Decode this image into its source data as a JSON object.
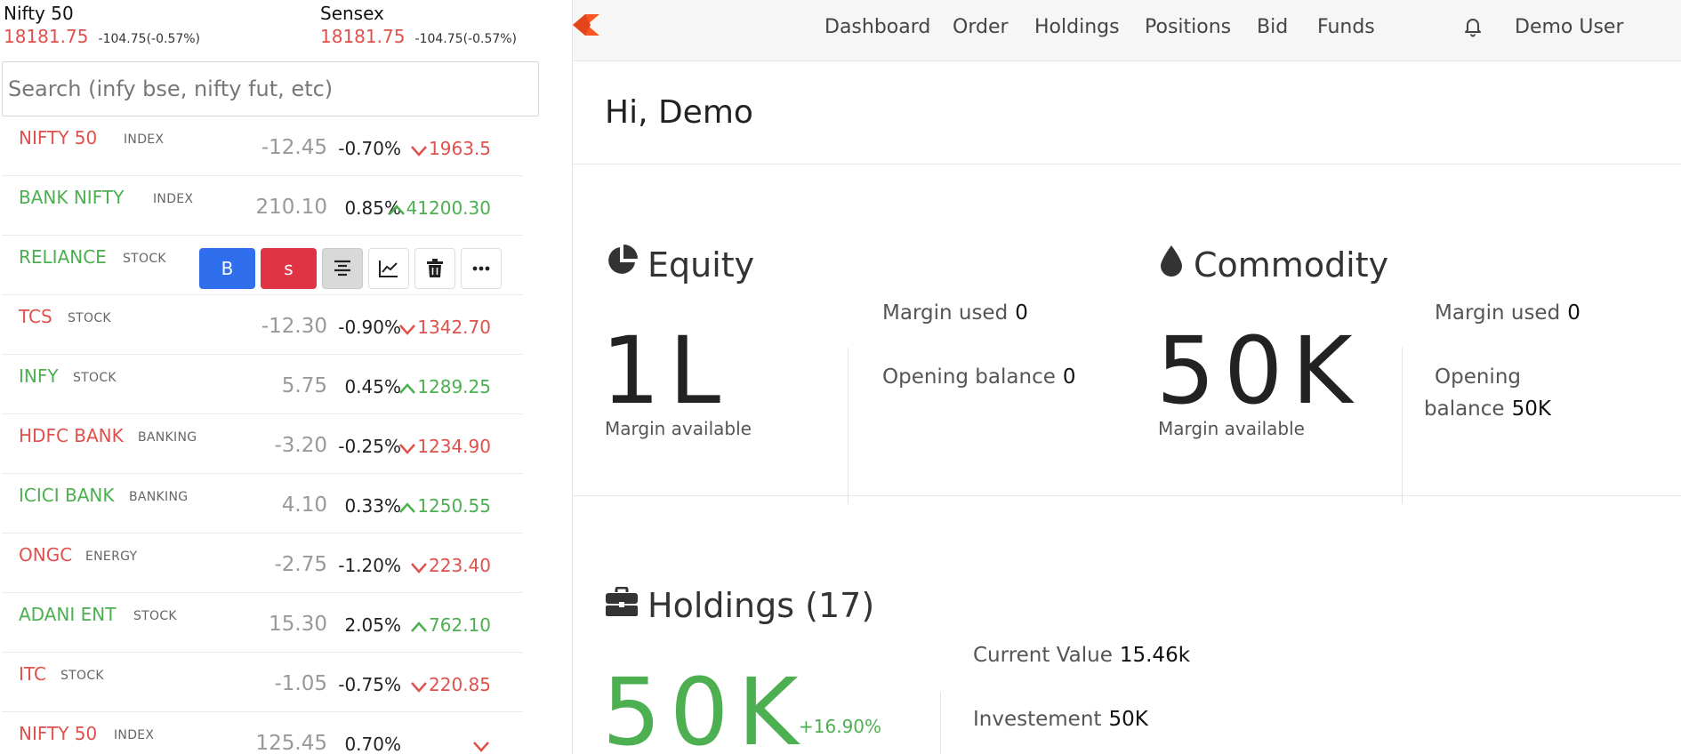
{
  "indices": [
    {
      "name": "Nifty 50",
      "price": "18181.75",
      "change": "-104.75(-0.57%)"
    },
    {
      "name": "Sensex",
      "price": "18181.75",
      "change": "-104.75(-0.57%)"
    }
  ],
  "search": {
    "placeholder": "Search (infy bse, nifty fut, etc)"
  },
  "watchlist": [
    {
      "name": "NIFTY 50",
      "type": "INDEX",
      "change": "-12.45",
      "pct": "-0.70%",
      "ltp": "1963.5",
      "dir": "down"
    },
    {
      "name": "BANK NIFTY",
      "type": "INDEX",
      "change": "210.10",
      "pct": "0.85%",
      "ltp": "41200.30",
      "dir": "up"
    },
    {
      "name": "RELIANCE",
      "type": "STOCK",
      "change": "",
      "pct": "",
      "ltp": "",
      "dir": "up"
    },
    {
      "name": "TCS",
      "type": "STOCK",
      "change": "-12.30",
      "pct": "-0.90%",
      "ltp": "1342.70",
      "dir": "down"
    },
    {
      "name": "INFY",
      "type": "STOCK",
      "change": "5.75",
      "pct": "0.45%",
      "ltp": "1289.25",
      "dir": "up"
    },
    {
      "name": "HDFC BANK",
      "type": "BANKING",
      "change": "-3.20",
      "pct": "-0.25%",
      "ltp": "1234.90",
      "dir": "down"
    },
    {
      "name": "ICICI BANK",
      "type": "BANKING",
      "change": "4.10",
      "pct": "0.33%",
      "ltp": "1250.55",
      "dir": "up"
    },
    {
      "name": "ONGC",
      "type": "ENERGY",
      "change": "-2.75",
      "pct": "-1.20%",
      "ltp": "223.40",
      "dir": "down"
    },
    {
      "name": "ADANI ENT",
      "type": "STOCK",
      "change": "15.30",
      "pct": "2.05%",
      "ltp": "762.10",
      "dir": "up"
    },
    {
      "name": "ITC",
      "type": "STOCK",
      "change": "-1.05",
      "pct": "-0.75%",
      "ltp": "220.85",
      "dir": "down"
    },
    {
      "name": "NIFTY 50",
      "type": "INDEX",
      "change": "125.45",
      "pct": "0.70%",
      "ltp": "",
      "dir": "down"
    }
  ],
  "row_actions": {
    "buy": "B",
    "sell": "s"
  },
  "nav": {
    "items": [
      "Dashboard",
      "Order",
      "Holdings",
      "Positions",
      "Bid",
      "Funds"
    ],
    "user": "Demo User",
    "brand_color": "#ff5722"
  },
  "greeting": "Hi, Demo",
  "equity": {
    "title": "Equity",
    "value": "1L",
    "value_label": "Margin available",
    "margin_used_label": "Margin used",
    "margin_used": "0",
    "opening_balance_label": "Opening balance",
    "opening_balance": "0"
  },
  "commodity": {
    "title": "Commodity",
    "value": "50K",
    "value_label": "Margin available",
    "margin_used_label": "Margin used",
    "margin_used": "0",
    "opening_balance_label_1": "Opening",
    "opening_balance_label_2": "balance",
    "opening_balance": "50K"
  },
  "holdings": {
    "title": "Holdings (17)",
    "value": "50K",
    "pnl_pct": "+16.90%",
    "current_value_label": "Current Value",
    "current_value": "15.46k",
    "investment_label": "Investement",
    "investment": "50K"
  },
  "colors": {
    "up": "#4caf50",
    "down": "#df514c",
    "buy": "#2f6fee",
    "sell": "#e03346"
  }
}
